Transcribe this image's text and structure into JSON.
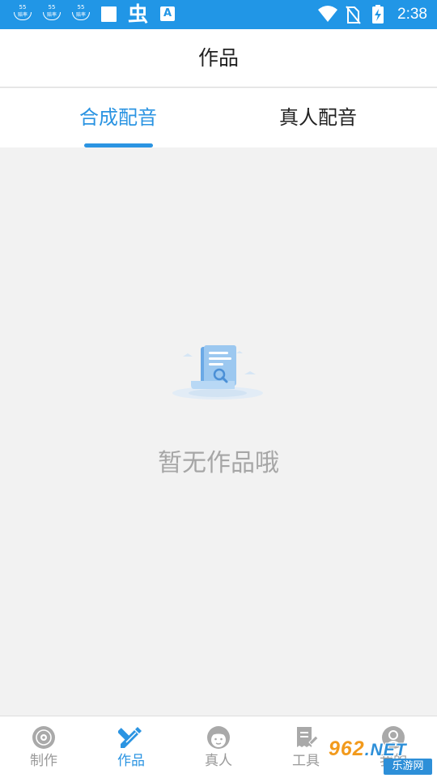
{
  "status_bar": {
    "notifications": [
      {
        "icon": "55-app-icon",
        "top_text": "55",
        "bottom_text": "赔率"
      },
      {
        "icon": "55-app-icon",
        "top_text": "55",
        "bottom_text": "赔率"
      },
      {
        "icon": "55-app-icon",
        "top_text": "55",
        "bottom_text": "赔率"
      },
      {
        "icon": "white-square-icon"
      },
      {
        "icon": "chong-app-icon",
        "text": "虫"
      },
      {
        "icon": "a-translate-icon",
        "text": "A"
      }
    ],
    "system_icons": [
      "wifi-icon",
      "no-sim-icon",
      "battery-charging-icon"
    ],
    "time": "2:38",
    "bg_color": "#2196e6"
  },
  "header": {
    "title": "作品"
  },
  "tabs": {
    "items": [
      {
        "label": "合成配音",
        "active": true
      },
      {
        "label": "真人配音",
        "active": false
      }
    ],
    "accent_color": "#2b94e2"
  },
  "empty_state": {
    "icon": "empty-document-search-icon",
    "message": "暂无作品哦"
  },
  "bottom_nav": {
    "items": [
      {
        "label": "制作",
        "icon": "disc-icon",
        "active": false
      },
      {
        "label": "作品",
        "icon": "pencil-ruler-icon",
        "active": true
      },
      {
        "label": "真人",
        "icon": "person-face-icon",
        "active": false
      },
      {
        "label": "工具",
        "icon": "receipt-tool-icon",
        "active": false
      },
      {
        "label": "我的",
        "icon": "user-icon",
        "active": false
      }
    ]
  },
  "watermark": {
    "top": "962",
    "suffix": ".NET",
    "bottom": "乐游网"
  }
}
